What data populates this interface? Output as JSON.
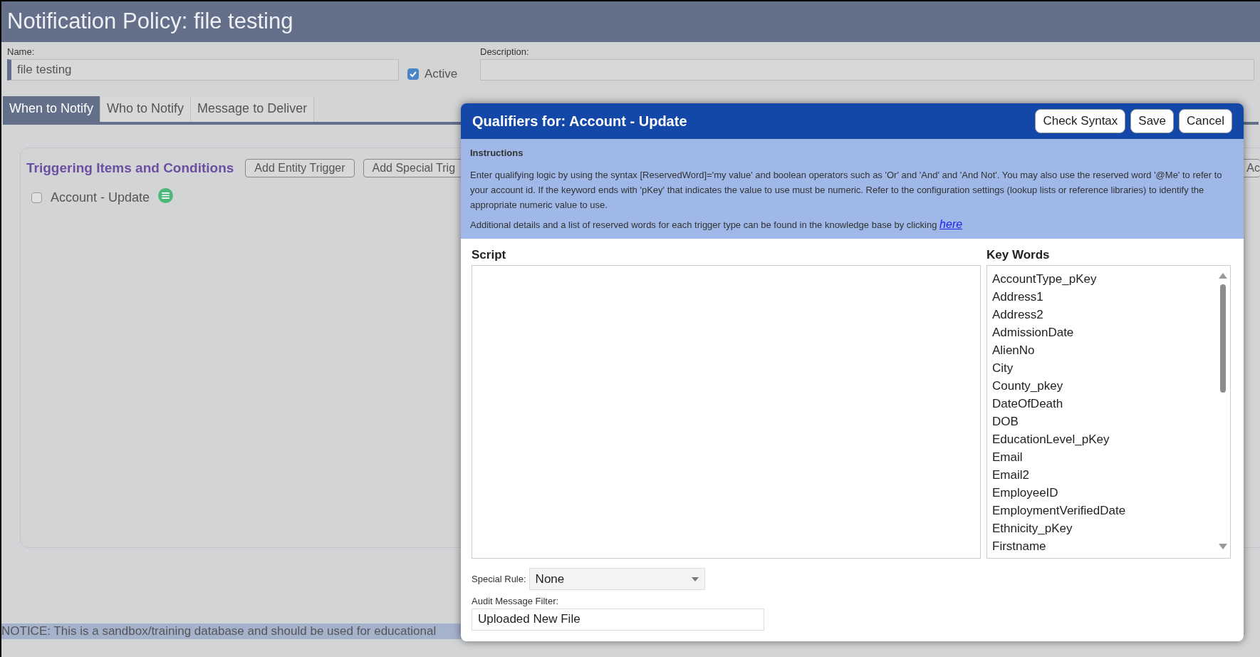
{
  "page_title": "Notification Policy: file testing",
  "name_field": {
    "label": "Name:",
    "value": "file testing"
  },
  "active": {
    "label": "Active",
    "checked": true
  },
  "description_field": {
    "label": "Description:"
  },
  "tabs": [
    {
      "label": "When to Notify",
      "selected": true
    },
    {
      "label": "Who to Notify",
      "selected": false
    },
    {
      "label": "Message to Deliver",
      "selected": false
    }
  ],
  "triggers_panel": {
    "title": "Triggering Items and Conditions",
    "buttons": [
      "Add Entity Trigger",
      "Add Special Trig",
      "Ac"
    ],
    "items": [
      {
        "label": "Account - Update",
        "checked": false
      }
    ]
  },
  "notice": "NOTICE: This is a sandbox/training database and should be used for educational",
  "dialog": {
    "title": "Qualifiers for: Account - Update",
    "buttons": [
      "Check Syntax",
      "Save",
      "Cancel"
    ],
    "instructions": {
      "heading": "Instructions",
      "text": "Enter qualifying logic by using the syntax [ReservedWord]='my value' and boolean operators such as 'Or' and 'And' and 'And Not'. You may also use the reserved word '@Me' to refer to your account id. If the keyword ends with 'pKey' that indicates the value to use must be numeric. Refer to the configuration settings (lookup lists or reference libraries) to identify the appropriate numeric value to use.",
      "more": "Additional details and a list of reserved words for each trigger type can be found in the knowledge base by clicking",
      "link": "here"
    },
    "script_label": "Script",
    "keywords_label": "Key Words",
    "keywords": [
      "AccountType_pKey",
      "Address1",
      "Address2",
      "AdmissionDate",
      "AlienNo",
      "City",
      "County_pkey",
      "DateOfDeath",
      "DOB",
      "EducationLevel_pKey",
      "Email",
      "Email2",
      "EmployeeID",
      "EmploymentVerifiedDate",
      "Ethnicity_pKey",
      "Firstname"
    ],
    "special_rule": {
      "label": "Special Rule:",
      "value": "None"
    },
    "audit_filter": {
      "label": "Audit Message Filter:",
      "value": "Uploaded New File"
    }
  }
}
